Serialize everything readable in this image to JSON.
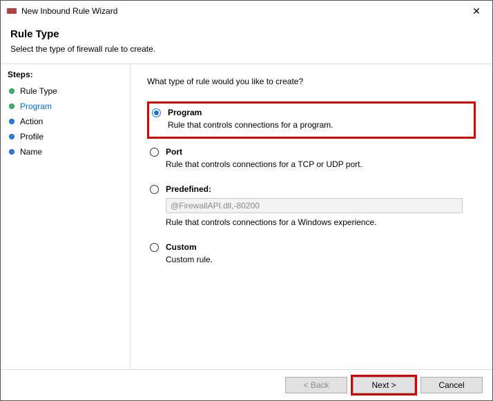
{
  "window": {
    "title": "New Inbound Rule Wizard"
  },
  "header": {
    "heading": "Rule Type",
    "subtitle": "Select the type of firewall rule to create."
  },
  "sidebar": {
    "steps_label": "Steps:",
    "items": [
      {
        "label": "Rule Type",
        "active": false
      },
      {
        "label": "Program",
        "active": true
      },
      {
        "label": "Action",
        "active": false
      },
      {
        "label": "Profile",
        "active": false
      },
      {
        "label": "Name",
        "active": false
      }
    ]
  },
  "main": {
    "question": "What type of rule would you like to create?",
    "options": {
      "program": {
        "title": "Program",
        "desc": "Rule that controls connections for a program."
      },
      "port": {
        "title": "Port",
        "desc": "Rule that controls connections for a TCP or UDP port."
      },
      "predefined": {
        "title": "Predefined:",
        "select_value": "@FirewallAPI.dll,-80200",
        "desc": "Rule that controls connections for a Windows experience."
      },
      "custom": {
        "title": "Custom",
        "desc": "Custom rule."
      }
    }
  },
  "footer": {
    "back": "< Back",
    "next": "Next >",
    "cancel": "Cancel"
  }
}
